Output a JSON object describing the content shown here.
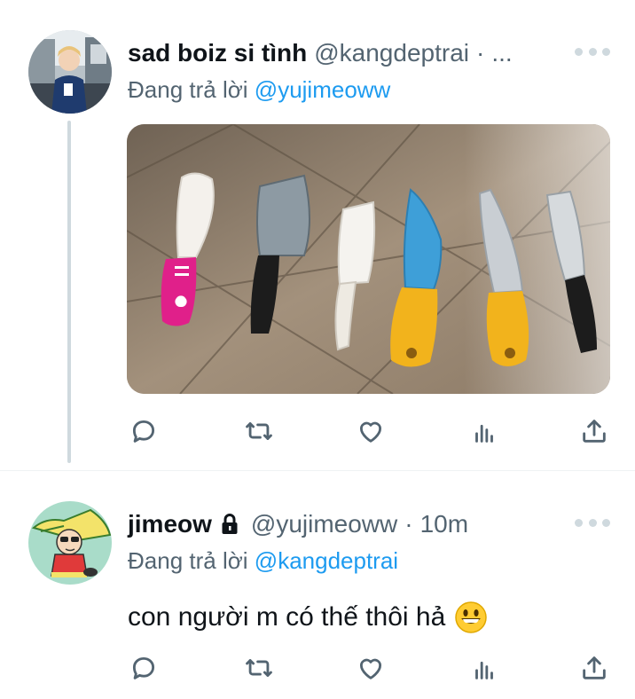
{
  "tweets": [
    {
      "author_name": "sad boiz si tình",
      "handle": "@kangdeptrai",
      "separator": "·",
      "time": "...",
      "replying_prefix": "Đang trả lời",
      "replying_to": "@yujimeoww",
      "has_media": true,
      "media_description": "six toy knives on a tiled floor",
      "actions": [
        "reply-icon",
        "retweet-icon",
        "like-icon",
        "analytics-icon",
        "share-icon"
      ]
    },
    {
      "author_name": "jimeow",
      "protected": true,
      "handle": "@yujimeoww",
      "separator": "·",
      "time": "10m",
      "replying_prefix": "Đang trả lời",
      "replying_to": "@kangdeptrai",
      "text": "con người m có thế thôi hả",
      "emoji": "grinning-face-emoji",
      "actions": [
        "reply-icon",
        "retweet-icon",
        "like-icon",
        "analytics-icon",
        "share-icon"
      ]
    }
  ],
  "colors": {
    "link": "#1d9bf0",
    "secondary_text": "#536471",
    "thread_line": "#cfd9de",
    "icon": "#536471"
  }
}
